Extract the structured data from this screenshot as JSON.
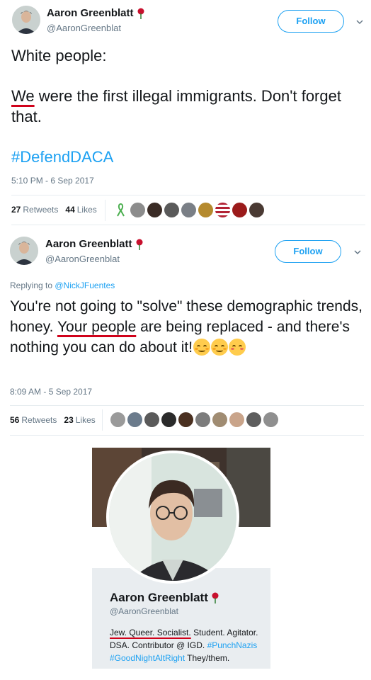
{
  "tweet1": {
    "name": "Aaron Greenblatt",
    "handle": "@AaronGreenblat",
    "follow_label": "Follow",
    "body_line1": "White people:",
    "body_underlined": "We",
    "body_rest": " were the first illegal immigrants. Don't forget that.",
    "hashtag": "#DefendDACA",
    "timestamp": "5:10 PM - 6 Sep 2017",
    "retweets_count": "27",
    "retweets_label": "Retweets",
    "likes_count": "44",
    "likes_label": "Likes"
  },
  "tweet2": {
    "name": "Aaron Greenblatt",
    "handle": "@AaronGreenblat",
    "follow_label": "Follow",
    "reply_prefix": "Replying to ",
    "reply_handle": "@NickJFuentes",
    "body_part1": "You're not going to \"solve\" these demographic trends, honey. ",
    "body_underlined": "Your people",
    "body_part2": " are being replaced - and there's nothing you can do about it!",
    "timestamp": "8:09 AM - 5 Sep 2017",
    "retweets_count": "56",
    "retweets_label": "Retweets",
    "likes_count": "23",
    "likes_label": "Likes"
  },
  "profile": {
    "name": "Aaron Greenblatt",
    "handle": "@AaronGreenblat",
    "bio_underlined": "Jew. Queer. Socialist.",
    "bio_part1": " Student. Agitator. DSA. Contributor @ IGD. ",
    "bio_hashtag1": "#PunchNazis",
    "bio_hashtag2": "#GoodNightAltRight",
    "bio_part2": " They/them."
  },
  "colors": {
    "accent": "#1da1f2",
    "underline": "#d0021b",
    "rose": "#c8102e",
    "muted": "#657786"
  },
  "icons": [
    "rose-icon",
    "chevron-down-icon",
    "emoji-smile-icon",
    "emoji-kiss-icon",
    "ribbon-icon"
  ]
}
